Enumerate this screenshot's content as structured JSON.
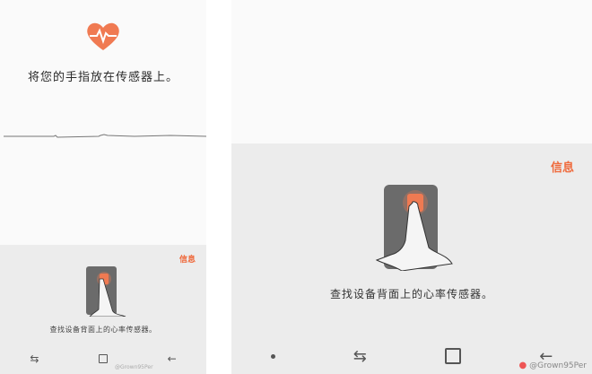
{
  "left": {
    "instruction": "将您的手指放在传感器上。",
    "info_label": "信息",
    "hint": "查找设备背面上的心率传感器。",
    "watermark": "@Grown95Per"
  },
  "right": {
    "info_label": "信息",
    "hint": "查找设备背面上的心率传感器。",
    "watermark": "@Grown95Per"
  },
  "colors": {
    "accent": "#ef6a3c",
    "heart": "#f07a52",
    "device": "#6b6b6b"
  },
  "icons": [
    "heart-rate-icon",
    "recents-icon",
    "home-icon",
    "back-icon",
    "dot-icon",
    "weibo-icon"
  ]
}
